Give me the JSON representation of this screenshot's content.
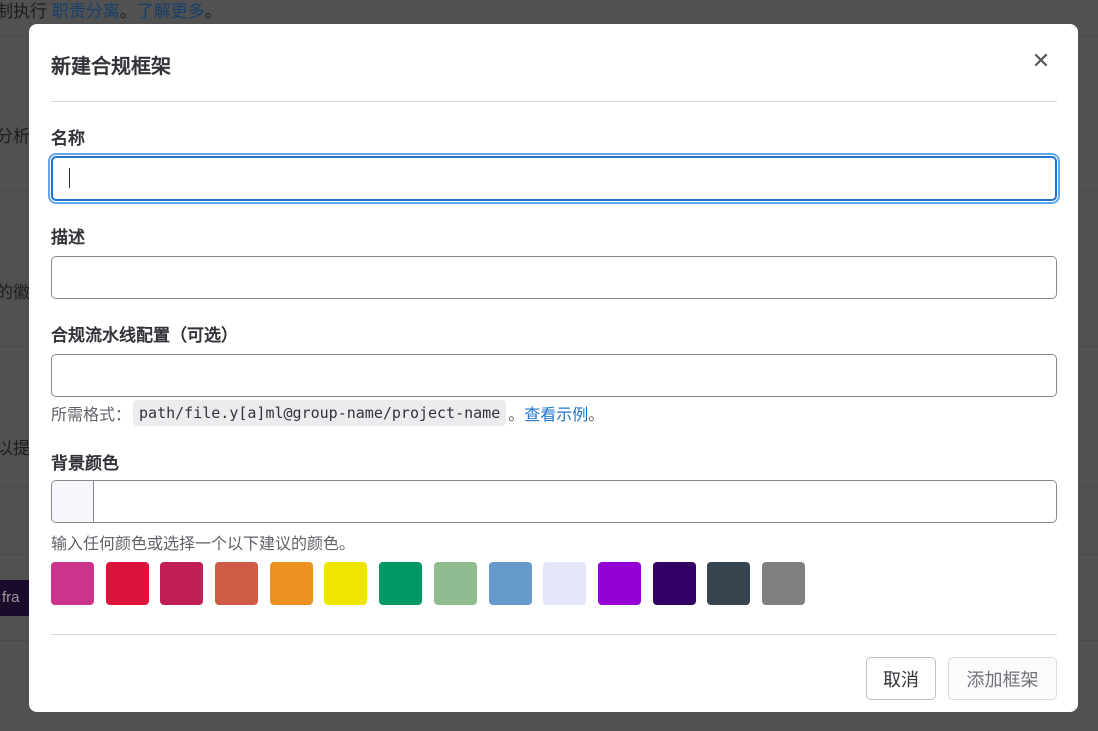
{
  "background": {
    "top_text": "制执行 ",
    "top_link1": "职责分离",
    "top_sep": "。",
    "top_link2": "了解更多",
    "top_end": "。",
    "fragments": [
      "分析",
      "的徽",
      "以提"
    ],
    "badge": "fra"
  },
  "modal": {
    "title": "新建合规框架",
    "close_icon": "close-icon",
    "name": {
      "label": "名称",
      "value": ""
    },
    "description": {
      "label": "描述",
      "value": ""
    },
    "pipeline": {
      "label": "合规流水线配置（可选）",
      "value": "",
      "help_prefix": "所需格式：",
      "help_code": "path/file.y[a]ml@group-name/project-name",
      "help_sep": "。",
      "help_link": "查看示例",
      "help_end": "。"
    },
    "color": {
      "label": "背景颜色",
      "value": "",
      "preview": "#f6f6fc",
      "help": "输入任何颜色或选择一个以下建议的颜色。",
      "suggestions": [
        "#cc338b",
        "#dc143c",
        "#c21e56",
        "#cd5b45",
        "#ed9121",
        "#eee600",
        "#009966",
        "#8fbc8f",
        "#6699cc",
        "#e6e6fa",
        "#9400d3",
        "#330066",
        "#36454f",
        "#808080"
      ]
    },
    "cancel_label": "取消",
    "submit_label": "添加框架",
    "accent": "#1f75cb"
  }
}
